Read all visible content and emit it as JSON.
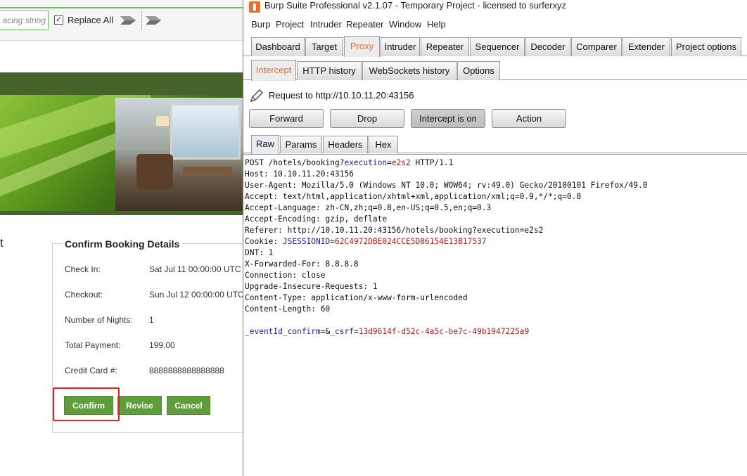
{
  "left_browser": {
    "find_bar": {
      "replace_placeholder": "acing string",
      "replace_all_checked": true,
      "replace_all_check_glyph": "✓",
      "replace_all_label": "Replace All",
      "find_next_icon": "arrow-right-icon",
      "find_prev_icon": "arrow-right-icon"
    },
    "left_fragment": "t",
    "booking": {
      "title": "Confirm Booking Details",
      "rows": [
        {
          "label": "Check In:",
          "value": "Sat Jul 11 00:00:00 UTC"
        },
        {
          "label": "Checkout:",
          "value": "Sun Jul 12 00:00:00 UTC"
        },
        {
          "label": "Number of Nights:",
          "value": "1"
        },
        {
          "label": "Total Payment:",
          "value": "199.00"
        },
        {
          "label": "Credit Card #:",
          "value": "8888888888888888"
        }
      ],
      "buttons": {
        "confirm": "Confirm",
        "revise": "Revise",
        "cancel": "Cancel"
      },
      "button_color": "#5e9e3a",
      "highlight_color": "#e42020"
    }
  },
  "burp": {
    "title": "Burp Suite Professional v2.1.07 - Temporary Project - licensed to surferxyz",
    "menu": [
      "Burp",
      "Project",
      "Intruder",
      "Repeater",
      "Window",
      "Help"
    ],
    "main_tabs": [
      "Dashboard",
      "Target",
      "Proxy",
      "Intruder",
      "Repeater",
      "Sequencer",
      "Decoder",
      "Comparer",
      "Extender",
      "Project options"
    ],
    "main_tab_active": "Proxy",
    "sub_tabs": [
      "Intercept",
      "HTTP history",
      "WebSockets history",
      "Options"
    ],
    "sub_tab_active": "Intercept",
    "accent_color": "#f06a2e",
    "request_to": "Request to http://10.10.11.20:43156",
    "actions": {
      "forward": "Forward",
      "drop": "Drop",
      "intercept": "Intercept is on",
      "action": "Action"
    },
    "view_tabs": [
      "Raw",
      "Params",
      "Headers",
      "Hex"
    ],
    "view_tab_active": "Raw",
    "request": {
      "l1_method": "POST /hotels/booking?",
      "l1_pname": "execution",
      "l1_eq": "=",
      "l1_pval": "e2s2",
      "l1_rest": " HTTP/1.1",
      "l2": "Host: 10.10.11.20:43156",
      "l3": "User-Agent: Mozilla/5.0 (Windows NT 10.0; WOW64; rv:49.0) Gecko/20100101 Firefox/49.0",
      "l4": "Accept: text/html,application/xhtml+xml,application/xml;q=0.9,*/*;q=0.8",
      "l5": "Accept-Language: zh-CN,zh;q=0.8,en-US;q=0.5,en;q=0.3",
      "l6": "Accept-Encoding: gzip, deflate",
      "l7": "Referer: http://10.10.11.20:43156/hotels/booking?execution=e2s2",
      "l8_key": "Cookie: ",
      "l8_cname": "JSESSIONID",
      "l8_eq": "=",
      "l8_cval": "62C4972DBE024CCE5D86154E13B17537",
      "l9": "DNT: 1",
      "l10": "X-Forwarded-For: 8.8.8.8",
      "l11": "Connection: close",
      "l12": "Upgrade-Insecure-Requests: 1",
      "l13": "Content-Type: application/x-www-form-urlencoded",
      "l14": "Content-Length: 60",
      "body_p1_name": "_eventId_confirm",
      "body_eq1": "=&",
      "body_p2_name": "_csrf",
      "body_eq2": "=",
      "body_p2_val": "13d9614f-d52c-4a5c-be7c-49b1947225a9",
      "param_name_color": "#1a1aa6",
      "param_value_color": "#b01818"
    },
    "icons": {
      "logo": "burp-logo-icon",
      "request_edit": "pencil-icon"
    }
  }
}
